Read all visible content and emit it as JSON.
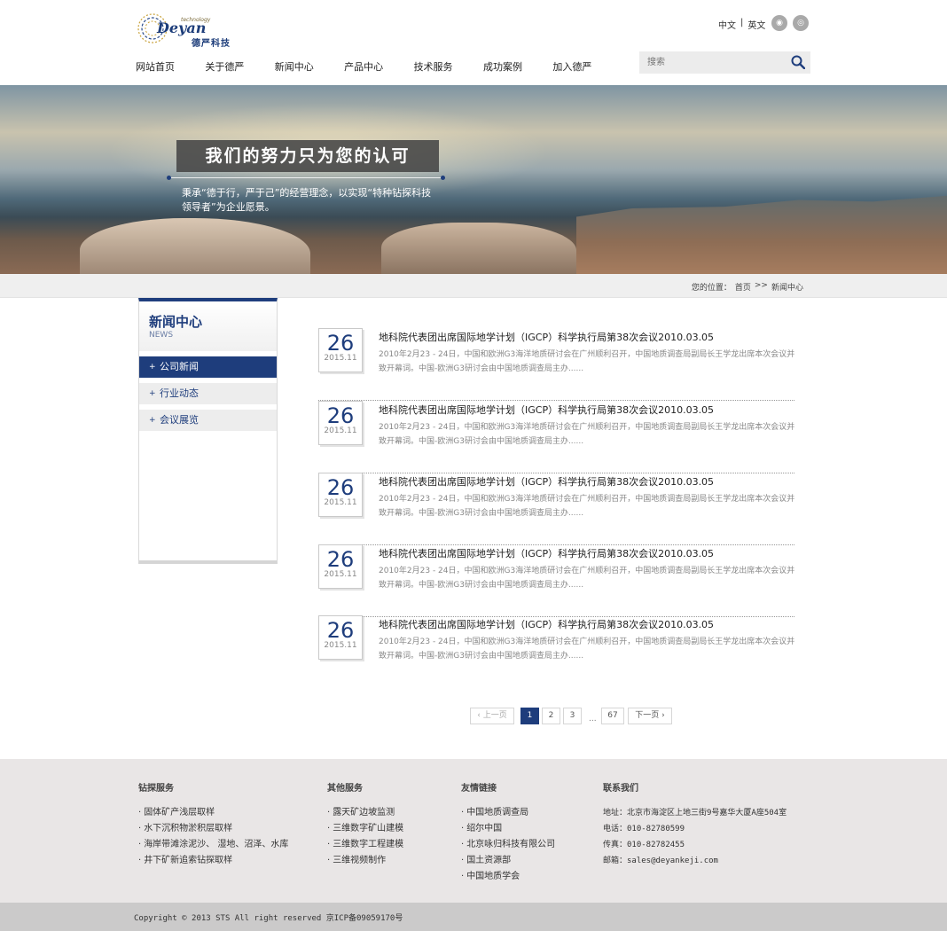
{
  "header": {
    "logo_word": "Deyan",
    "logo_small": "technology",
    "logo_cn": "德严科技",
    "lang": {
      "zh": "中文",
      "sep": "|",
      "en": "英文"
    },
    "nav": [
      "网站首页",
      "关于德严",
      "新闻中心",
      "产品中心",
      "技术服务",
      "成功案例",
      "加入德严"
    ],
    "search_placeholder": "搜索"
  },
  "banner": {
    "title": "我们的努力只为您的认可",
    "subtitle": "秉承“德于行，严于己”的经营理念，以实现“特种钻探科技领导者”为企业愿景。"
  },
  "breadcrumb": {
    "prefix": "您的位置：",
    "home": "首页",
    "sep": ">>",
    "current": "新闻中心"
  },
  "sidebar": {
    "title": "新闻中心",
    "subtitle": "NEWS",
    "items": [
      {
        "label": "公司新闻",
        "active": true
      },
      {
        "label": "行业动态",
        "active": false
      },
      {
        "label": "会议展览",
        "active": false
      }
    ]
  },
  "news": [
    {
      "day": "26",
      "ym": "2015.11",
      "title": "地科院代表团出席国际地学计划（IGCP）科学执行局第38次会议2010.03.05",
      "desc": "2010年2月23 - 24日，中国和欧洲G3海洋地质研讨会在广州顺利召开，中国地质调查局副局长王学龙出席本次会议并致开幕词。中国-欧洲G3研讨会由中国地质调查局主办......"
    },
    {
      "day": "26",
      "ym": "2015.11",
      "title": "地科院代表团出席国际地学计划（IGCP）科学执行局第38次会议2010.03.05",
      "desc": "2010年2月23 - 24日，中国和欧洲G3海洋地质研讨会在广州顺利召开，中国地质调查局副局长王学龙出席本次会议并致开幕词。中国-欧洲G3研讨会由中国地质调查局主办......"
    },
    {
      "day": "26",
      "ym": "2015.11",
      "title": "地科院代表团出席国际地学计划（IGCP）科学执行局第38次会议2010.03.05",
      "desc": "2010年2月23 - 24日，中国和欧洲G3海洋地质研讨会在广州顺利召开，中国地质调查局副局长王学龙出席本次会议并致开幕词。中国-欧洲G3研讨会由中国地质调查局主办......"
    },
    {
      "day": "26",
      "ym": "2015.11",
      "title": "地科院代表团出席国际地学计划（IGCP）科学执行局第38次会议2010.03.05",
      "desc": "2010年2月23 - 24日，中国和欧洲G3海洋地质研讨会在广州顺利召开，中国地质调查局副局长王学龙出席本次会议并致开幕词。中国-欧洲G3研讨会由中国地质调查局主办......"
    },
    {
      "day": "26",
      "ym": "2015.11",
      "title": "地科院代表团出席国际地学计划（IGCP）科学执行局第38次会议2010.03.05",
      "desc": "2010年2月23 - 24日，中国和欧洲G3海洋地质研讨会在广州顺利召开，中国地质调查局副局长王学龙出席本次会议并致开幕词。中国-欧洲G3研讨会由中国地质调查局主办......"
    }
  ],
  "pager": {
    "prev": "上一页",
    "pages": [
      "1",
      "2",
      "3"
    ],
    "ellipsis": "...",
    "last": "67",
    "next": "下一页",
    "current": "1"
  },
  "footer": {
    "col1": {
      "title": "钻探服务",
      "links": [
        "固体矿产浅层取样",
        "水下沉积物淤积层取样",
        "海岸带滩涂泥沙、 湿地、沼泽、水库",
        "井下矿新追索钻探取样"
      ]
    },
    "col2": {
      "title": "其他服务",
      "links": [
        "露天矿边坡监测",
        "三维数字矿山建模",
        "三维数字工程建模",
        "三维视频制作"
      ]
    },
    "col3": {
      "title": "友情链接",
      "links": [
        "中国地质调查局",
        "绍尔中国",
        "北京咏归科技有限公司",
        "国土资源部",
        "中国地质学会"
      ]
    },
    "col4": {
      "title": "联系我们",
      "lines": [
        "地址：北京市海淀区上地三街9号嘉华大厦A座504室",
        "电话：010-82780599",
        "传真：010-82782455",
        "邮箱：sales@deyankeji.com"
      ]
    },
    "copyright": "Copyright © 2013 STS All right reserved 京ICP备09059170号"
  }
}
